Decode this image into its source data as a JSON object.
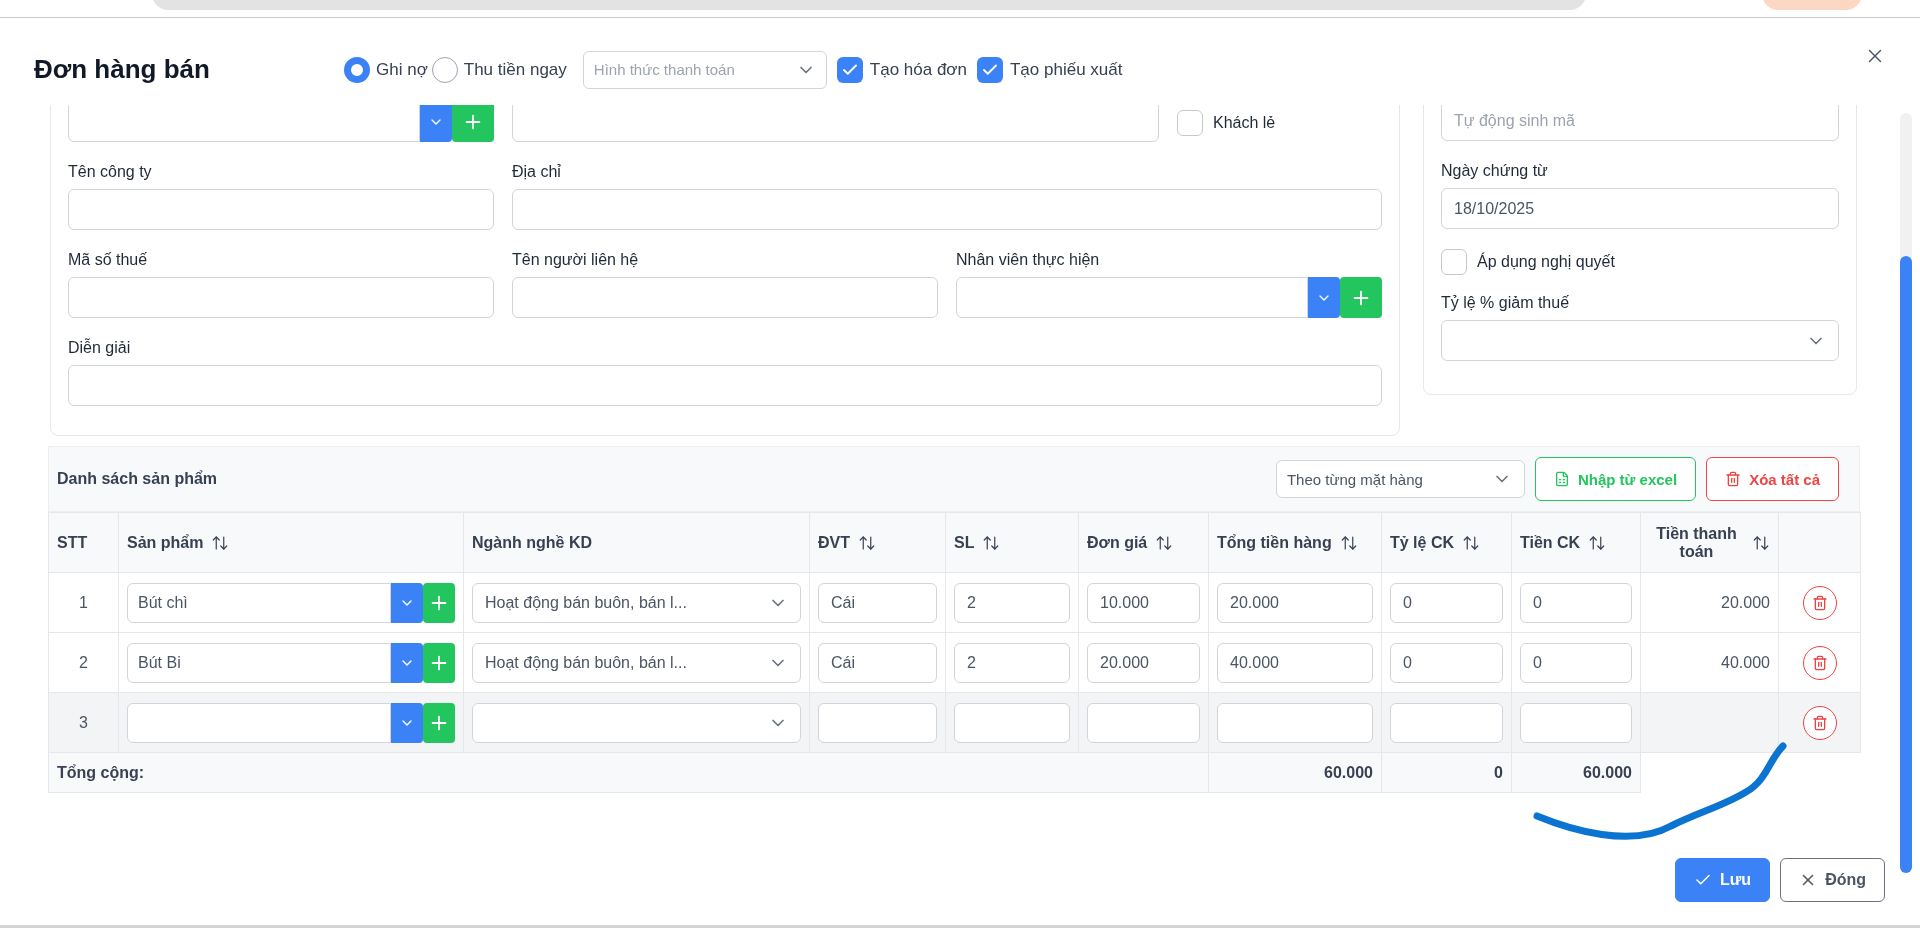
{
  "window": {
    "title": "Đơn hàng bán"
  },
  "header": {
    "payment_modes": [
      {
        "label": "Ghi nợ",
        "selected": true
      },
      {
        "label": "Thu tiền ngay",
        "selected": false
      }
    ],
    "payment_method": {
      "placeholder": "Hình thức thanh toán"
    },
    "options": [
      {
        "label": "Tạo hóa đơn",
        "checked": true
      },
      {
        "label": "Tạo phiếu xuất",
        "checked": true
      }
    ]
  },
  "customer": {
    "walk_in": {
      "label": "Khách lẻ",
      "checked": false
    },
    "company": {
      "label": "Tên công ty"
    },
    "address": {
      "label": "Địa chỉ"
    },
    "tax_code": {
      "label": "Mã số thuế"
    },
    "contact": {
      "label": "Tên người liên hệ"
    },
    "staff": {
      "label": "Nhân viên thực hiện"
    },
    "description": {
      "label": "Diễn giải"
    }
  },
  "document": {
    "code": {
      "placeholder": "Tự động sinh mã"
    },
    "date": {
      "label": "Ngày chứng từ",
      "value": "18/10/2025"
    },
    "resolution": {
      "label": "Áp dụng nghị quyết",
      "checked": false
    },
    "tax_reduction": {
      "label": "Tỷ lệ % giảm thuế"
    }
  },
  "products": {
    "title": "Danh sách sản phẩm",
    "mode": "Theo từng mặt hàng",
    "import_button": "Nhập từ excel",
    "clear_button": "Xóa tất cả",
    "columns": [
      {
        "label": "STT",
        "sortable": false
      },
      {
        "label": "Sản phẩm",
        "sortable": true
      },
      {
        "label": "Ngành nghề KD",
        "sortable": false
      },
      {
        "label": "ĐVT",
        "sortable": true
      },
      {
        "label": "SL",
        "sortable": true
      },
      {
        "label": "Đơn giá",
        "sortable": true
      },
      {
        "label": "Tổng tiền hàng",
        "sortable": true
      },
      {
        "label": "Tỷ lệ CK",
        "sortable": true
      },
      {
        "label": "Tiền CK",
        "sortable": true
      },
      {
        "label": "Tiền thanh toán",
        "sortable": true
      }
    ],
    "rows": [
      {
        "stt": "1",
        "product": "Bút chì",
        "industry": "Hoạt động bán buôn, bán l...",
        "unit": "Cái",
        "qty": "2",
        "price": "10.000",
        "amount": "20.000",
        "discount_rate": "0",
        "discount": "0",
        "payment": "20.000",
        "highlighted": false
      },
      {
        "stt": "2",
        "product": "Bút Bi",
        "industry": "Hoạt động bán buôn, bán l...",
        "unit": "Cái",
        "qty": "2",
        "price": "20.000",
        "amount": "40.000",
        "discount_rate": "0",
        "discount": "0",
        "payment": "40.000",
        "highlighted": false
      },
      {
        "stt": "3",
        "highlighted": true
      }
    ],
    "totals": {
      "label": "Tổng cộng:",
      "values": [
        "60.000",
        "0",
        "60.000"
      ]
    }
  },
  "footer": {
    "buttons": [
      {
        "label": "Lưu",
        "kind": "primary"
      },
      {
        "label": "Đóng",
        "kind": "secondary"
      }
    ]
  }
}
